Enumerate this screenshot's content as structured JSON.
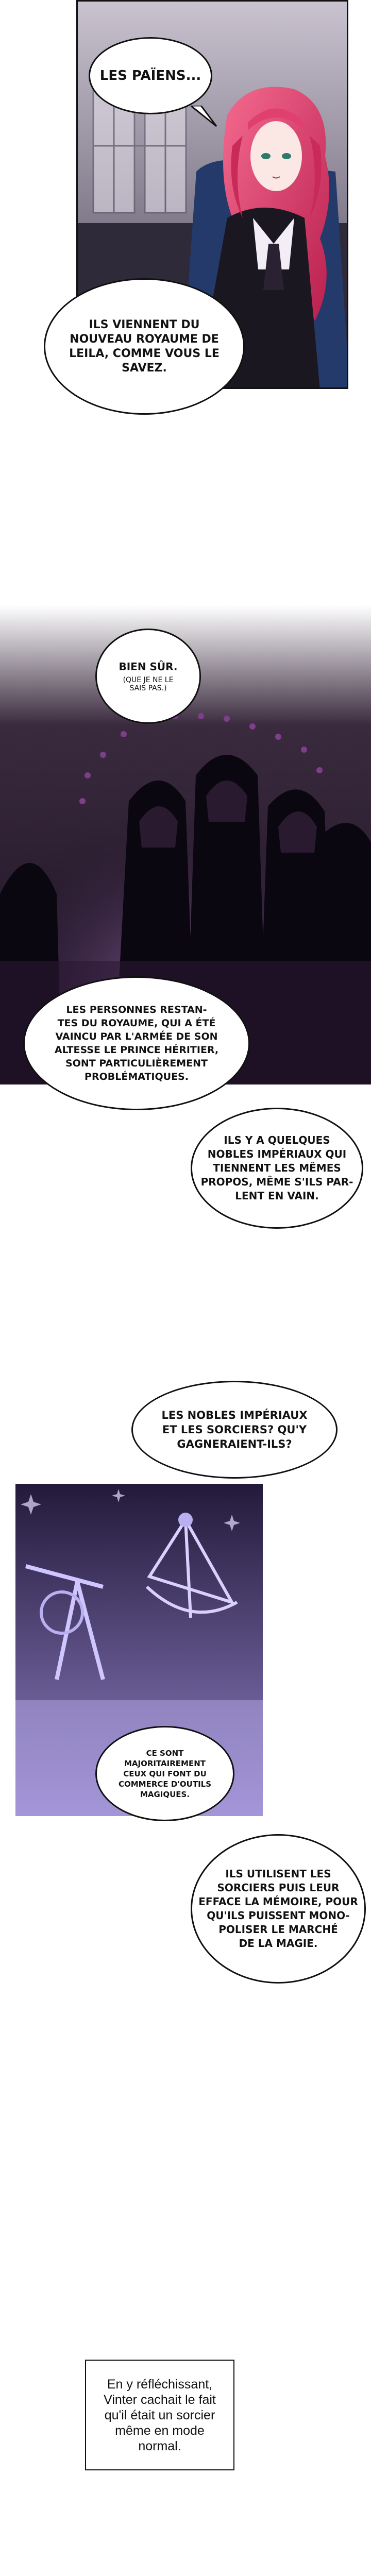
{
  "page": {
    "background": "#ffffff"
  },
  "panel1": {
    "bubble_top": "LES PAÏENS...",
    "bubble_bottom": "ILS VIENNENT DU\nNOUVEAU ROYAUME DE\nLEILA, COMME VOUS LE\nSAVEZ."
  },
  "panel2": {
    "bubble_main": "BIEN SÛR.",
    "bubble_aside": "(QUE JE NE LE\nSAIS PAS.)",
    "bubble_a": "LES PERSONNES RESTAN-\nTES DU ROYAUME, QUI A ÉTÉ\nVAINCU PAR L'ARMÉE DE SON\nALTESSE LE PRINCE HÉRITIER,\nSONT PARTICULIÈREMENT\nPROBLÉMATIQUES.",
    "bubble_b": "ILS Y A QUELQUES\nNOBLES IMPÉRIAUX QUI\nTIENNENT LES MÊMES\nPROPOS, MÊME S'ILS PAR-\nLENT EN VAIN."
  },
  "panel3": {
    "bubble_top": "LES NOBLES IMPÉRIAUX\nET LES SORCIERS? QU'Y\nGAGNERAIENT-ILS?",
    "bubble_a": "CE SONT\nMAJORITAIREMENT\nCEUX QUI FONT DU\nCOMMERCE D'OUTILS\nMAGIQUES.",
    "bubble_b": "ILS UTILISENT LES\nSORCIERS PUIS LEUR\nEFFACE LA MÉMOIRE, POUR\nQU'ILS PUISSENT MONO-\nPOLISER LE MARCHÉ\nDE LA MAGIE."
  },
  "caption": {
    "text": "En y réfléchissant,\nVinter cachait le fait\nqu'il était un sorcier\nmême en mode\nnormal."
  },
  "colors": {
    "hair": "#e0406e",
    "night": "#1a1020",
    "purple": "#6b3a86",
    "instrument": "#b9b0f0"
  }
}
